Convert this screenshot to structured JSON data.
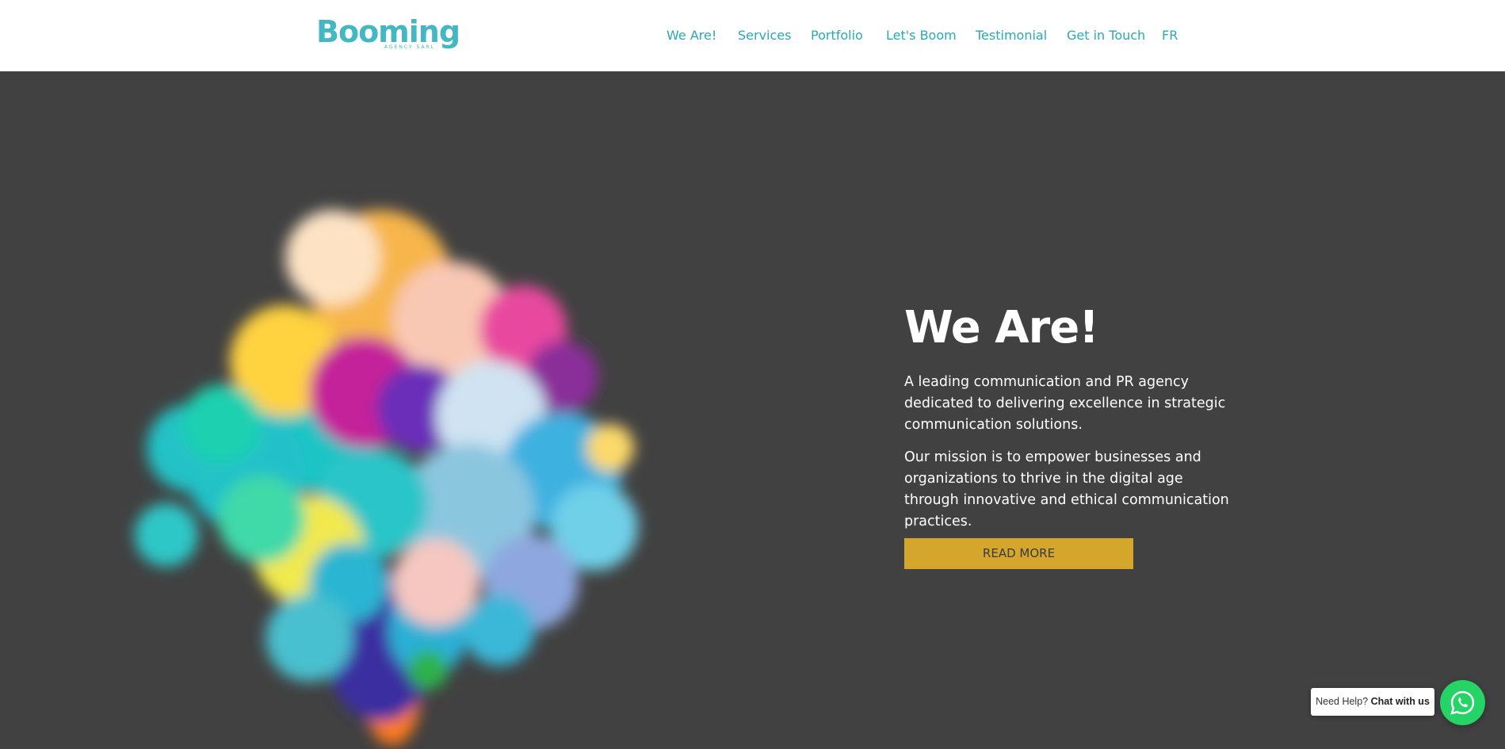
{
  "header": {
    "logo": {
      "word": "Booming",
      "sub": "AGENCY SARL"
    },
    "nav": [
      {
        "label": "We Are!"
      },
      {
        "label": "Services"
      },
      {
        "label": "Portfolio"
      },
      {
        "label": "Let's Boom"
      },
      {
        "label": "Testimonial"
      },
      {
        "label": "Get in Touch"
      },
      {
        "label": "FR"
      }
    ]
  },
  "hero": {
    "image_icon": "colorful-smoke-explosion-image",
    "title": "We Are!",
    "paragraphs": [
      "A leading communication and PR agency dedicated to delivering excellence in strategic communication solutions.",
      "Our mission is to empower businesses and organizations to thrive in the digital age through innovative and ethical communication practices."
    ],
    "cta_label": "READ MORE"
  },
  "chat": {
    "help_prefix": "Need Help?",
    "help_strong": "Chat with us",
    "icon": "whatsapp-icon"
  },
  "colors": {
    "brand": "#43b8c3",
    "nav_text": "#2aa9b5",
    "hero_bg": "#414141",
    "cta_bg": "#d4a72c",
    "whatsapp": "#25d366"
  }
}
